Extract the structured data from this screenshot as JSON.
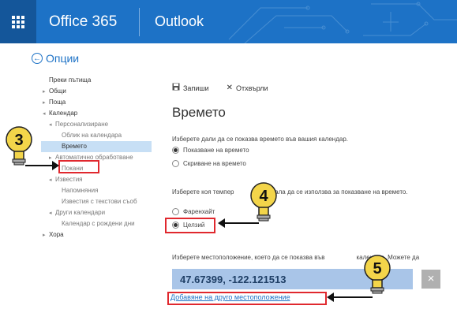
{
  "header": {
    "brand": "Office 365",
    "app": "Outlook",
    "color": "#1d72c6",
    "menu_icon": "waffle-icon"
  },
  "back": {
    "label": "Опции",
    "icon": "back-arrow-icon"
  },
  "sidebar": {
    "heading": "Преки пътища",
    "items": [
      {
        "label": "Общи",
        "arrow": "▸"
      },
      {
        "label": "Поща",
        "arrow": "▸"
      },
      {
        "label": "Календар",
        "arrow": "◂"
      },
      {
        "label": "Персонализиране",
        "arrow": "◂"
      },
      {
        "label": "Облик на календара"
      },
      {
        "label": "Времето"
      },
      {
        "label": "Автоматично обработване",
        "arrow": "▸"
      },
      {
        "label": "Покани"
      },
      {
        "label": "Известия",
        "arrow": "◂"
      },
      {
        "label": "Напомняния"
      },
      {
        "label": "Известия с текстови съоб"
      },
      {
        "label": "Други календари",
        "arrow": "◂"
      },
      {
        "label": "Календар с рождени дни"
      },
      {
        "label": "Хора",
        "arrow": "▸"
      }
    ]
  },
  "toolbar": {
    "save_label": "Запиши",
    "discard_label": "Отхвърли"
  },
  "main": {
    "title": "Времето",
    "q1": "Изберете дали да се показва времето във вашия календар.",
    "opt_show": "Показване на времето",
    "opt_hide": "Скриване на времето",
    "q2_a": "Изберете коя темпер",
    "q2_b": "кала да се използва за показване на времето.",
    "opt_f": "Фаренхайт",
    "opt_c": "Целзий",
    "q3_a": "Изберете местоположение, което да се показва във",
    "q3_b": "календар. Можете да",
    "location_value": "47.67399, -122.121513",
    "remove_label": "×",
    "add_link": "Добавяне на друго местоположение"
  },
  "callouts": [
    {
      "number": "3"
    },
    {
      "number": "4"
    },
    {
      "number": "5"
    }
  ],
  "accent_red": "#e0282e",
  "callout_yellow": "#f3d54a"
}
